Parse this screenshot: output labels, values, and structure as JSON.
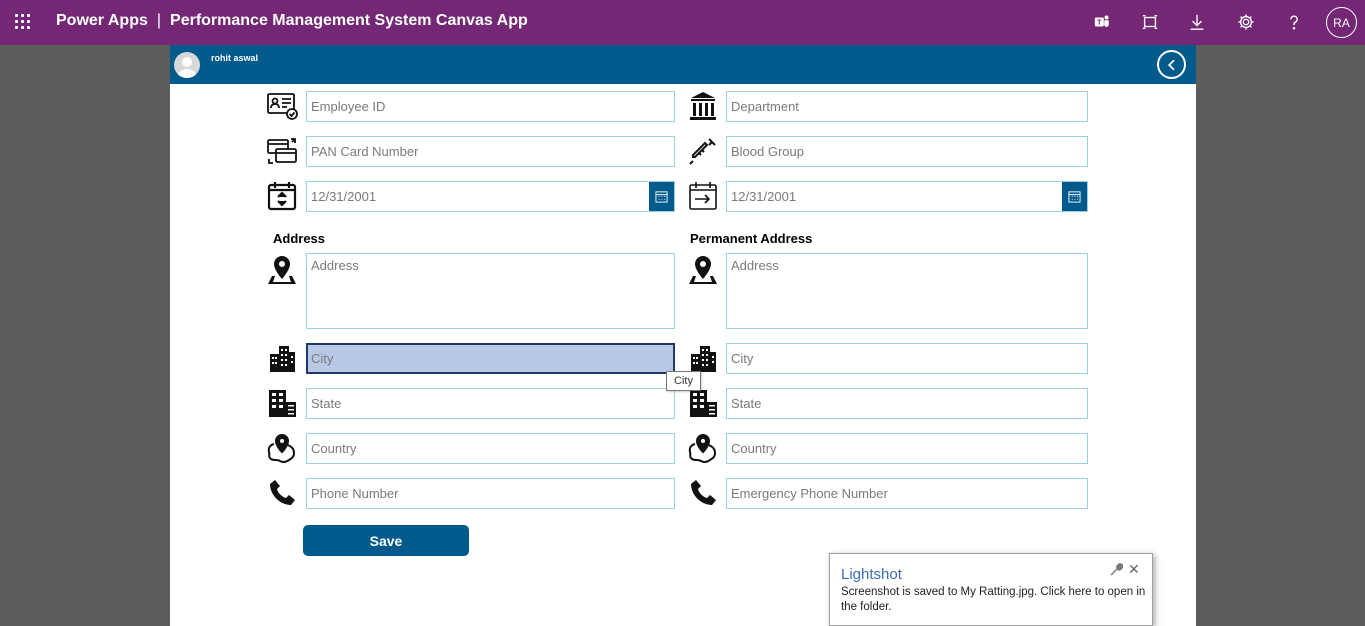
{
  "topbar": {
    "product": "Power Apps",
    "separator": "|",
    "app_title": "Performance Management System Canvas App",
    "user_initials": "RA",
    "icons": [
      "teams-icon",
      "fit-screen-icon",
      "download-icon",
      "settings-icon",
      "help-icon"
    ]
  },
  "app_header": {
    "username": "rohit aswal"
  },
  "form": {
    "employee_id": {
      "placeholder": "Employee ID"
    },
    "department": {
      "placeholder": "Department"
    },
    "pan_card": {
      "placeholder": "PAN Card Number"
    },
    "blood_group": {
      "placeholder": "Blood Group"
    },
    "dob": {
      "value": "12/31/2001"
    },
    "doj": {
      "value": "12/31/2001"
    },
    "address_label": "Address",
    "permanent_address_label": "Permanent Address",
    "address": {
      "placeholder": "Address"
    },
    "perm_address": {
      "placeholder": "Address"
    },
    "city": {
      "placeholder": "City"
    },
    "perm_city": {
      "placeholder": "City"
    },
    "state": {
      "placeholder": "State"
    },
    "perm_state": {
      "placeholder": "State"
    },
    "country": {
      "placeholder": "Country"
    },
    "perm_country": {
      "placeholder": "Country"
    },
    "phone": {
      "placeholder": "Phone Number"
    },
    "emergency_phone": {
      "placeholder": "Emergency Phone Number"
    },
    "city_tooltip": "City",
    "save_label": "Save"
  },
  "lightshot": {
    "title": "Lightshot",
    "message": "Screenshot is saved to My Ratting.jpg. Click here to open in the folder."
  },
  "colors": {
    "topbar": "#742774",
    "header": "#005a8c",
    "field_border": "#9cd0e4",
    "active_field": "#b8c9e6"
  }
}
